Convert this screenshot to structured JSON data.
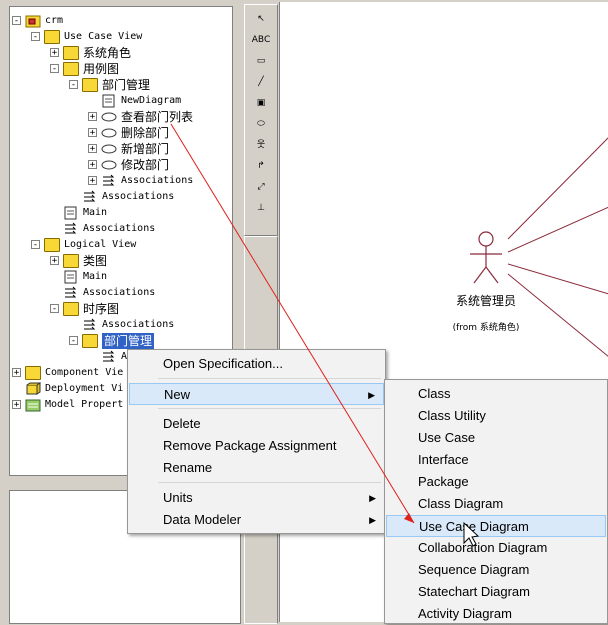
{
  "browser": {
    "tree": [
      {
        "label": "crm",
        "depth": 0,
        "toggle": "-",
        "icon": "root-model"
      },
      {
        "label": "Use Case View",
        "depth": 1,
        "toggle": "-",
        "icon": "folder"
      },
      {
        "label": "系统角色",
        "depth": 2,
        "toggle": "+",
        "icon": "folder",
        "cjk": true
      },
      {
        "label": "用例图",
        "depth": 2,
        "toggle": "-",
        "icon": "folder",
        "cjk": true
      },
      {
        "label": "部门管理",
        "depth": 3,
        "toggle": "-",
        "icon": "folder",
        "cjk": true
      },
      {
        "label": "NewDiagram",
        "depth": 4,
        "toggle": "",
        "icon": "usecase-diagram"
      },
      {
        "label": "查看部门列表",
        "depth": 4,
        "toggle": "+",
        "icon": "usecase",
        "cjk": true
      },
      {
        "label": "删除部门",
        "depth": 4,
        "toggle": "+",
        "icon": "usecase",
        "cjk": true
      },
      {
        "label": "新增部门",
        "depth": 4,
        "toggle": "+",
        "icon": "usecase",
        "cjk": true
      },
      {
        "label": "修改部门",
        "depth": 4,
        "toggle": "+",
        "icon": "usecase",
        "cjk": true
      },
      {
        "label": "Associations",
        "depth": 4,
        "toggle": "+",
        "icon": "associations"
      },
      {
        "label": "Associations",
        "depth": 3,
        "toggle": "",
        "icon": "associations"
      },
      {
        "label": "Main",
        "depth": 2,
        "toggle": "",
        "icon": "usecase-diagram"
      },
      {
        "label": "Associations",
        "depth": 2,
        "toggle": "",
        "icon": "associations"
      },
      {
        "label": "Logical View",
        "depth": 1,
        "toggle": "-",
        "icon": "folder"
      },
      {
        "label": "类图",
        "depth": 2,
        "toggle": "+",
        "icon": "folder",
        "cjk": true
      },
      {
        "label": "Main",
        "depth": 2,
        "toggle": "",
        "icon": "class-diagram"
      },
      {
        "label": "Associations",
        "depth": 2,
        "toggle": "",
        "icon": "associations"
      },
      {
        "label": "时序图",
        "depth": 2,
        "toggle": "-",
        "icon": "folder",
        "cjk": true
      },
      {
        "label": "Associations",
        "depth": 3,
        "toggle": "",
        "icon": "associations"
      },
      {
        "label": "部门管理",
        "depth": 3,
        "toggle": "-",
        "icon": "folder",
        "cjk": true,
        "selected": true
      },
      {
        "label": "Ass",
        "depth": 4,
        "toggle": "",
        "icon": "associations"
      },
      {
        "label": "Component Vie",
        "depth": 0,
        "toggle": "+",
        "icon": "folder"
      },
      {
        "label": "Deployment Vi",
        "depth": 0,
        "toggle": "",
        "icon": "deployment"
      },
      {
        "label": "Model Propert",
        "depth": 0,
        "toggle": "+",
        "icon": "model-properties"
      }
    ]
  },
  "toolbox": {
    "tools": [
      {
        "name": "selection-arrow-tool",
        "glyph": "↖"
      },
      {
        "name": "text-box-tool",
        "glyph": "ABC"
      },
      {
        "name": "note-tool",
        "glyph": "▭"
      },
      {
        "name": "anchor-note-tool",
        "glyph": "╱"
      },
      {
        "name": "package-tool",
        "glyph": "▣"
      },
      {
        "name": "use-case-tool",
        "glyph": "⬭"
      },
      {
        "name": "actor-tool",
        "glyph": "웃"
      },
      {
        "name": "association-tool",
        "glyph": "↱"
      },
      {
        "name": "dependency-tool",
        "glyph": "⤢"
      },
      {
        "name": "generalization-tool",
        "glyph": "⊥"
      }
    ]
  },
  "diagram": {
    "actor_name": "系统管理员",
    "actor_from": "(from 系统角色)"
  },
  "context_menu": {
    "items": [
      {
        "label": "Open Specification...",
        "submenu": false
      },
      {
        "sep": true
      },
      {
        "label": "New",
        "submenu": true,
        "highlighted": true
      },
      {
        "sep": true
      },
      {
        "label": "Delete",
        "submenu": false
      },
      {
        "label": "Remove Package Assignment",
        "submenu": false
      },
      {
        "label": "Rename",
        "submenu": false
      },
      {
        "sep": true
      },
      {
        "label": "Units",
        "submenu": true
      },
      {
        "label": "Data Modeler",
        "submenu": true
      }
    ]
  },
  "new_submenu": {
    "items": [
      {
        "label": "Class"
      },
      {
        "label": "Class Utility"
      },
      {
        "label": "Use Case"
      },
      {
        "label": "Interface"
      },
      {
        "label": "Package"
      },
      {
        "label": "Class Diagram"
      },
      {
        "label": "Use Case Diagram",
        "highlighted": true
      },
      {
        "label": "Collaboration Diagram"
      },
      {
        "label": "Sequence Diagram"
      },
      {
        "label": "Statechart Diagram"
      },
      {
        "label": "Activity Diagram"
      }
    ]
  },
  "annotation": {
    "arrow_color": "#e0201a"
  }
}
